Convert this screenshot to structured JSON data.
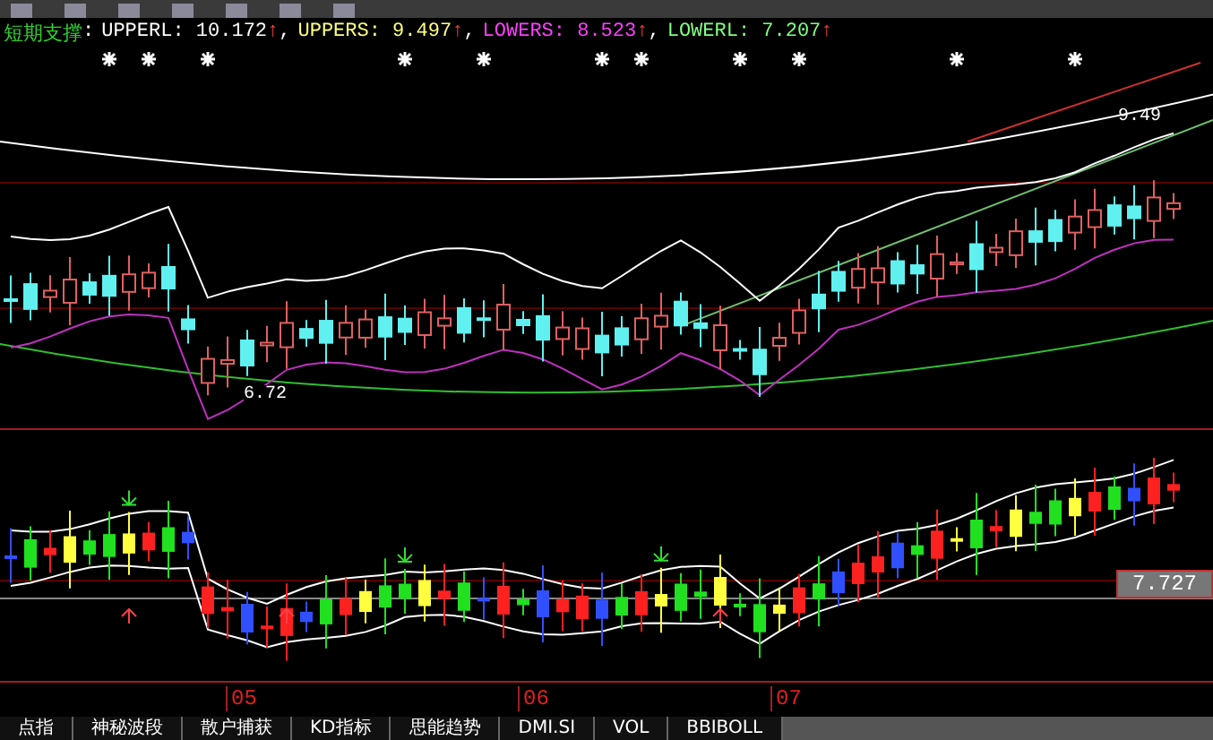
{
  "formula_title": "短期支撑",
  "indicators": [
    {
      "separator": ":",
      "name": "UPPERL:",
      "value": "10.172",
      "arrow": "↑",
      "color": "#ffffff"
    },
    {
      "separator": ",",
      "name": "UPPERS:",
      "value": "9.497",
      "arrow": "↑",
      "color": "#ffff80"
    },
    {
      "separator": ",",
      "name": "LOWERS:",
      "value": "8.523",
      "arrow": "↑",
      "color": "#ff40ff"
    },
    {
      "separator": ",",
      "name": "LOWERL:",
      "value": "7.207",
      "arrow": "↑",
      "color": "#80ff80"
    }
  ],
  "price_labels": {
    "low": "6.72",
    "high": "9.49"
  },
  "price_tag": "7.727",
  "months": [
    "05",
    "06",
    "07"
  ],
  "tabs": [
    {
      "label": "点指",
      "selected": false
    },
    {
      "label": "神秘波段",
      "selected": false
    },
    {
      "label": "散户捕获",
      "selected": false
    },
    {
      "label": "KD指标",
      "selected": false
    },
    {
      "label": "思能趋势",
      "selected": false
    },
    {
      "label": "DMI.SI",
      "selected": false
    },
    {
      "label": "VOL",
      "selected": false
    },
    {
      "label": "BBIBOLL",
      "selected": false
    }
  ]
}
